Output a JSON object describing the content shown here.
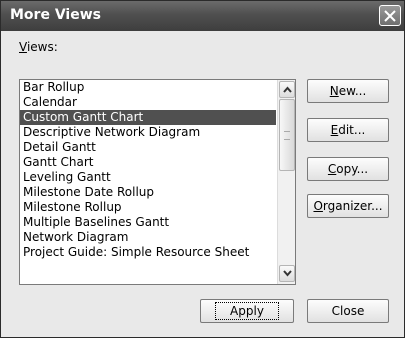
{
  "window": {
    "title": "More Views"
  },
  "views": {
    "label_underlined": "V",
    "label_rest": "iews:",
    "items": [
      "Bar Rollup",
      "Calendar",
      "Custom Gantt Chart",
      "Descriptive Network Diagram",
      "Detail Gantt",
      "Gantt Chart",
      "Leveling Gantt",
      "Milestone Date Rollup",
      "Milestone Rollup",
      "Multiple Baselines Gantt",
      "Network Diagram",
      "Project Guide: Simple Resource Sheet"
    ],
    "selected": "Custom Gantt Chart"
  },
  "buttons": {
    "new": {
      "mnemonic": "N",
      "rest": "ew..."
    },
    "edit": {
      "mnemonic": "E",
      "rest": "dit..."
    },
    "copy": {
      "mnemonic": "C",
      "rest": "opy..."
    },
    "organizer": {
      "mnemonic": "O",
      "rest": "rganizer..."
    },
    "apply": "Apply",
    "close": "Close"
  },
  "icons": [
    "close-icon",
    "scroll-up-icon",
    "scroll-down-icon"
  ],
  "colors": {
    "selection": "#505050",
    "titlebar": "#4f4f4f"
  }
}
